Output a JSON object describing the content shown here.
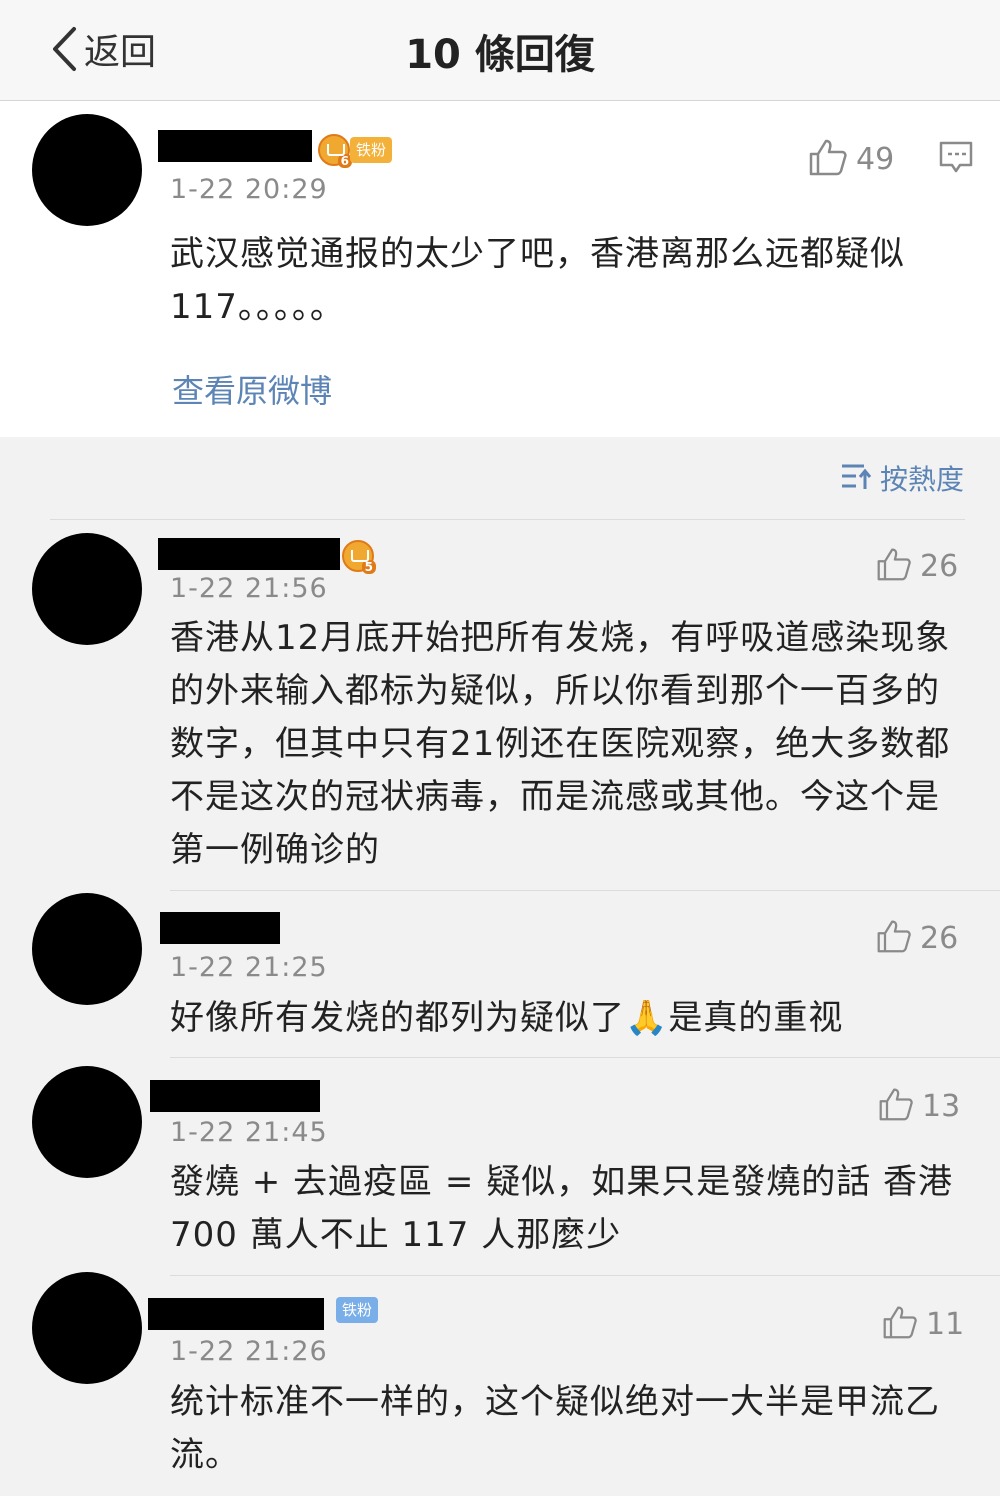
{
  "nav": {
    "back_label": "返回",
    "title": "10 條回復"
  },
  "original_post": {
    "badge": "铁粉",
    "level": "6",
    "time": "1-22 20:29",
    "likes": "49",
    "content_line1": "武汉感觉通报的太少了吧，香港离那么远都疑似",
    "content_line2": "117。。。。。",
    "view_original": "查看原微博"
  },
  "sort": {
    "label": "按熱度"
  },
  "replies": [
    {
      "level": "5",
      "time": "1-22 21:56",
      "likes": "26",
      "lines": [
        "香港从12月底开始把所有发烧，有呼吸道感染现象",
        "的外来输入都标为疑似，所以你看到那个一百多的",
        "数字，但其中只有21例还在医院观察，绝大多数都",
        "不是这次的冠状病毒，而是流感或其他。今这个是",
        "第一例确诊的"
      ]
    },
    {
      "time": "1-22 21:25",
      "likes": "26",
      "lines": [
        "好像所有发烧的都列为疑似了🙏是真的重视"
      ]
    },
    {
      "time": "1-22 21:45",
      "likes": "13",
      "lines": [
        "發燒 + 去過疫區 = 疑似，如果只是發燒的話 香港",
        "700 萬人不止 117 人那麼少"
      ]
    },
    {
      "badge": "铁粉",
      "time": "1-22 21:26",
      "likes": "11",
      "lines": [
        "统计标准不一样的，这个疑似绝对一大半是甲流乙",
        "流。"
      ]
    }
  ],
  "colors": {
    "link": "#5c84b4",
    "meta": "#8a8a8a",
    "badge_gold": "#f3b13a",
    "badge_blue": "#7aaee8"
  }
}
